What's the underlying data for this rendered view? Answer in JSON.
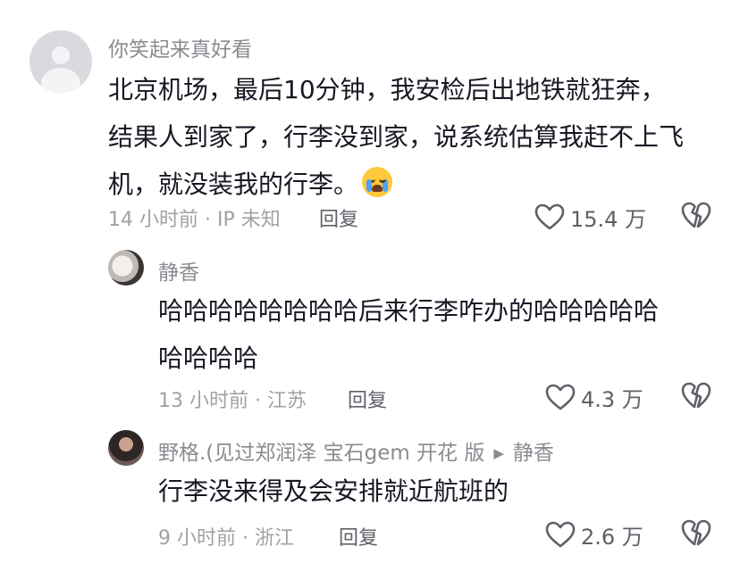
{
  "comments": [
    {
      "username": "你笑起来真好看",
      "lines": [
        "北京机场，最后10分钟，我安检后出地铁就狂奔，",
        "结果人到家了，行李没到家，说系统估算我赶不上飞",
        "机，就没装我的行李。"
      ],
      "emoji": "loudly-crying-face",
      "meta": "14 小时前 · IP 未知",
      "reply_label": "回复",
      "likes": "15.4 万"
    },
    {
      "username": "静香",
      "lines": [
        "哈哈哈哈哈哈哈哈后来行李咋办的哈哈哈哈哈",
        "哈哈哈哈"
      ],
      "meta": "13 小时前 · 江苏",
      "reply_label": "回复",
      "likes": "4.3 万"
    },
    {
      "username": "野格.(见过郑润泽 宝石gem 开花 版",
      "reply_to": "静香",
      "lines": [
        "行李没来得及会安排就近航班的"
      ],
      "meta": "9 小时前 · 浙江",
      "reply_label": "回复",
      "likes": "2.6 万"
    }
  ]
}
